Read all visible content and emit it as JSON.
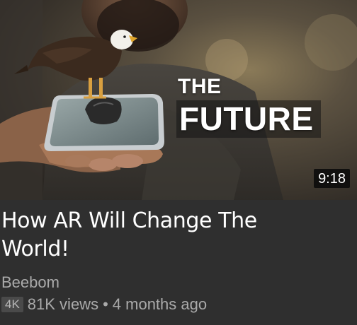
{
  "thumbnail": {
    "overlay_line1": "THE",
    "overlay_line2": "FUTURE",
    "duration": "9:18"
  },
  "video": {
    "title": "How AR Will Change The World!",
    "channel": "Beebom",
    "quality_badge": "4K",
    "views": "81K views",
    "separator": "•",
    "age": "4 months ago"
  },
  "colors": {
    "background": "#2f2f2f",
    "secondary_text": "#aaaaaa",
    "badge_bg": "#4a4a4a"
  }
}
